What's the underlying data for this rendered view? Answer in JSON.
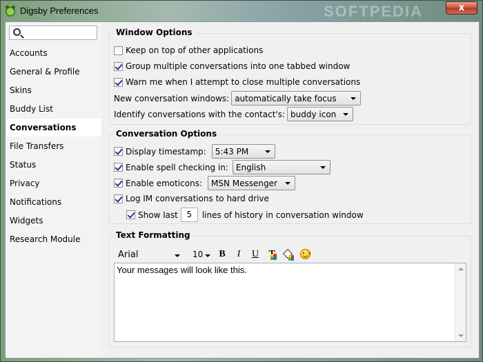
{
  "window": {
    "title": "Digsby Preferences",
    "watermark": "SOFTPEDIA",
    "close_label": "x"
  },
  "sidebar": {
    "search_placeholder": "",
    "items": [
      {
        "label": "Accounts"
      },
      {
        "label": "General & Profile"
      },
      {
        "label": "Skins"
      },
      {
        "label": "Buddy List"
      },
      {
        "label": "Conversations",
        "active": true
      },
      {
        "label": "File Transfers"
      },
      {
        "label": "Status"
      },
      {
        "label": "Privacy"
      },
      {
        "label": "Notifications"
      },
      {
        "label": "Widgets"
      },
      {
        "label": "Research Module"
      }
    ]
  },
  "window_options": {
    "title": "Window Options",
    "keep_on_top": {
      "label": "Keep on top of other applications",
      "checked": false
    },
    "group_tabbed": {
      "label": "Group multiple conversations into one tabbed window",
      "checked": true
    },
    "warn_close": {
      "label": "Warn me when I attempt to close multiple conversations",
      "checked": true
    },
    "new_conv_label": "New conversation windows:",
    "new_conv_value": "automatically take focus",
    "identify_label": "Identify conversations with the contact's:",
    "identify_value": "buddy icon"
  },
  "conversation_options": {
    "title": "Conversation Options",
    "timestamp": {
      "label": "Display timestamp:",
      "checked": true,
      "value": "5:43 PM"
    },
    "spellcheck": {
      "label": "Enable spell checking in:",
      "checked": true,
      "value": "English"
    },
    "emoticons": {
      "label": "Enable emoticons:",
      "checked": true,
      "value": "MSN Messenger"
    },
    "log": {
      "label": "Log IM conversations to hard drive",
      "checked": true
    },
    "show_last": {
      "label": "Show last",
      "checked": true,
      "value": "5",
      "suffix": "lines of history in conversation window"
    }
  },
  "text_formatting": {
    "title": "Text Formatting",
    "font": "Arial",
    "size": "10",
    "bold": "B",
    "italic": "I",
    "underline": "U",
    "text_color_glyph": "T",
    "preview_text": "Your messages will look like this."
  },
  "colors": {
    "close_button": "#c9513a",
    "active_nav_bg": "#ffffff",
    "check_mark": "#21398c"
  }
}
